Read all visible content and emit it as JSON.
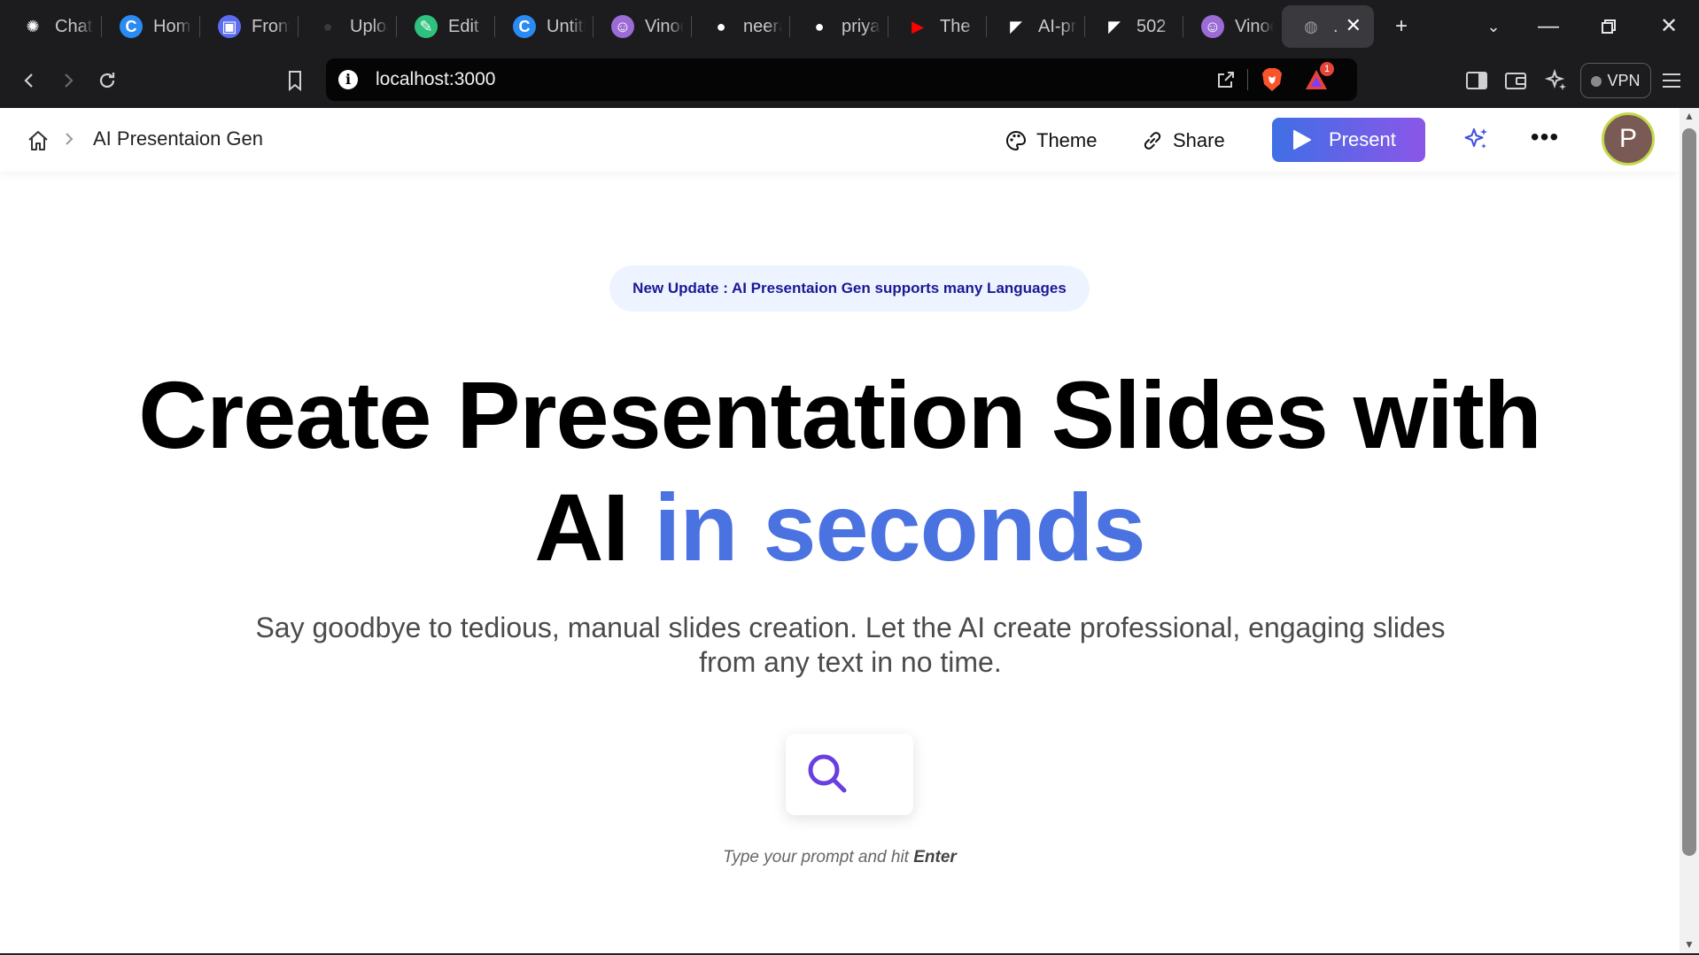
{
  "browser": {
    "tabs": [
      {
        "label": "ChatGPT",
        "icon": "chatgpt-icon",
        "color": "#ffffff"
      },
      {
        "label": "Home",
        "icon": "canva-icon",
        "color": "#2a8bf2"
      },
      {
        "label": "Frontend",
        "icon": "printer-icon",
        "color": "#5b6cf0"
      },
      {
        "label": "Upload",
        "icon": "github-icon",
        "color": "#3a3a3a"
      },
      {
        "label": "Edit",
        "icon": "edit-icon",
        "color": "#2ec27e"
      },
      {
        "label": "Untitled",
        "icon": "canva-icon",
        "color": "#2a8bf2"
      },
      {
        "label": "Vinod",
        "icon": "avatar-icon",
        "color": "#9b6cd6"
      },
      {
        "label": "neeraj",
        "icon": "github-icon",
        "color": "#ffffff"
      },
      {
        "label": "priya",
        "icon": "github-icon",
        "color": "#ffffff"
      },
      {
        "label": "The",
        "icon": "youtube-icon",
        "color": "#ff0000"
      },
      {
        "label": "AI-presentation",
        "icon": "vercel-icon",
        "color": "#ffffff"
      },
      {
        "label": "502",
        "icon": "vercel-icon",
        "color": "#ffffff"
      },
      {
        "label": "Vinod",
        "icon": "avatar-icon",
        "color": "#9b6cd6"
      },
      {
        "label": ".",
        "icon": "globe-icon",
        "color": "#9a9a9e",
        "active": true
      }
    ],
    "new_tab": "+",
    "url": "localhost:3000",
    "vpn_label": "VPN",
    "rewards_badge": "1"
  },
  "header": {
    "breadcrumb_title": "AI Presentaion Gen",
    "theme_label": "Theme",
    "share_label": "Share",
    "present_label": "Present",
    "avatar_initial": "P"
  },
  "main": {
    "announcement": "New Update : AI Presentaion Gen supports many Languages",
    "headline_part1": "Create Presentation Slides with AI",
    "headline_highlight": "in seconds",
    "subtitle": "Say goodbye to tedious, manual slides creation. Let the AI create professional, engaging slides from any text in no time.",
    "hint_prefix": "Type your prompt and hit",
    "hint_key": "Enter"
  },
  "colors": {
    "accent_blue": "#4a72e0",
    "present_gradient_start": "#3f6fe6",
    "present_gradient_end": "#8b56e8",
    "announcement_text": "#1b1896",
    "announcement_bg": "#eef4ff",
    "search_icon": "#6a3fe0"
  }
}
